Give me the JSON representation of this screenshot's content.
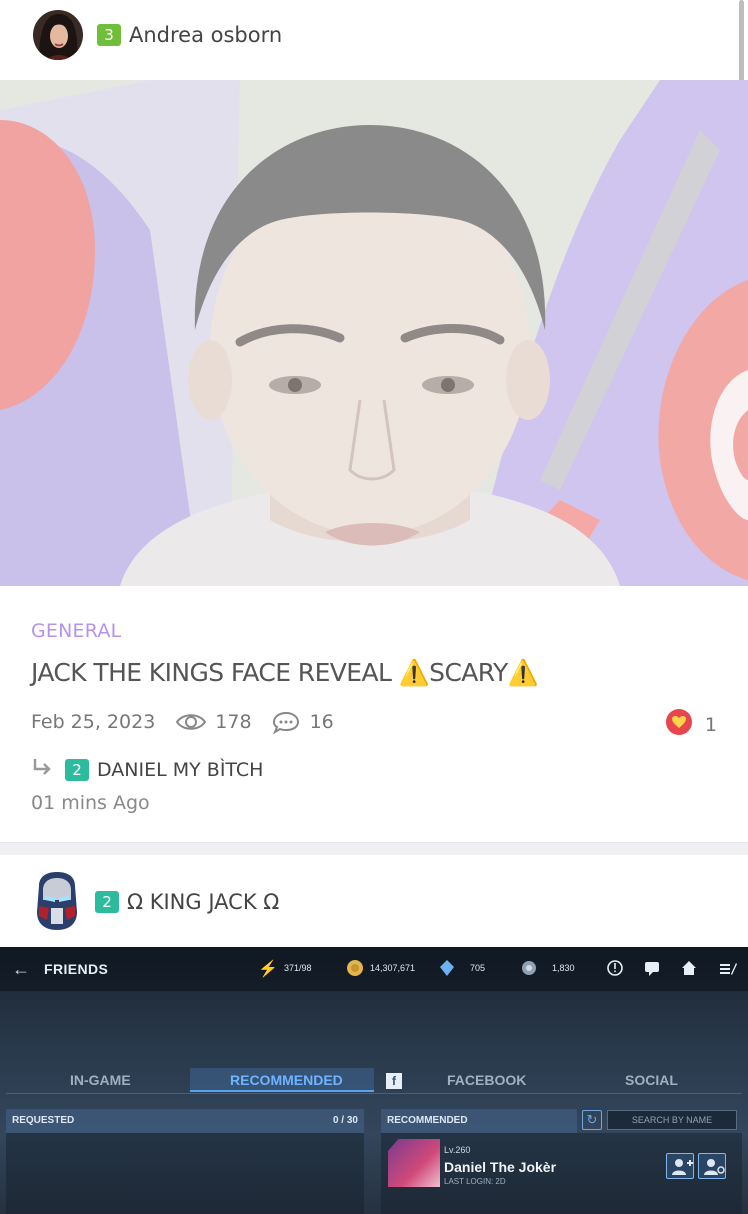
{
  "post": {
    "author": {
      "level": "3",
      "name": "Andrea osborn",
      "avatar_icon": "dark-haired-woman-avatar"
    },
    "category": "GENERAL",
    "title": "JACK THE KINGS FACE REVEAL ⚠️SCARY⚠️",
    "date": "Feb 25, 2023",
    "views": "178",
    "comments": "16",
    "likes": "1",
    "latest_reply": {
      "level": "2",
      "name": "DANIEL MY BÌTCH",
      "time": "01 mins Ago"
    }
  },
  "next_post": {
    "author": {
      "level": "2",
      "name": "Ω KING JACK Ω",
      "avatar_icon": "iron-helmet-avatar"
    }
  },
  "game_screen": {
    "back_icon": "back-arrow-icon",
    "title": "FRIENDS",
    "stats": {
      "energy": "371/98",
      "gold": "14,307,671",
      "crystals": "705",
      "units": "1,830"
    },
    "tabs": [
      "IN-GAME",
      "RECOMMENDED",
      "FACEBOOK",
      "SOCIAL"
    ],
    "active_tab": "RECOMMENDED",
    "requested": {
      "label": "REQUESTED",
      "count": "0 / 30"
    },
    "recommended": {
      "label": "RECOMMENDED",
      "search_placeholder": "SEARCH BY NAME"
    },
    "friend": {
      "level": "Lv.260",
      "name": "Daniel The Jokèr",
      "last_login": "LAST LOGIN: 2D"
    }
  },
  "colors": {
    "category": "#b594e8",
    "badge_green": "#6fbf3a",
    "badge_teal": "#2dbb9d",
    "like_red": "#e8454f"
  }
}
